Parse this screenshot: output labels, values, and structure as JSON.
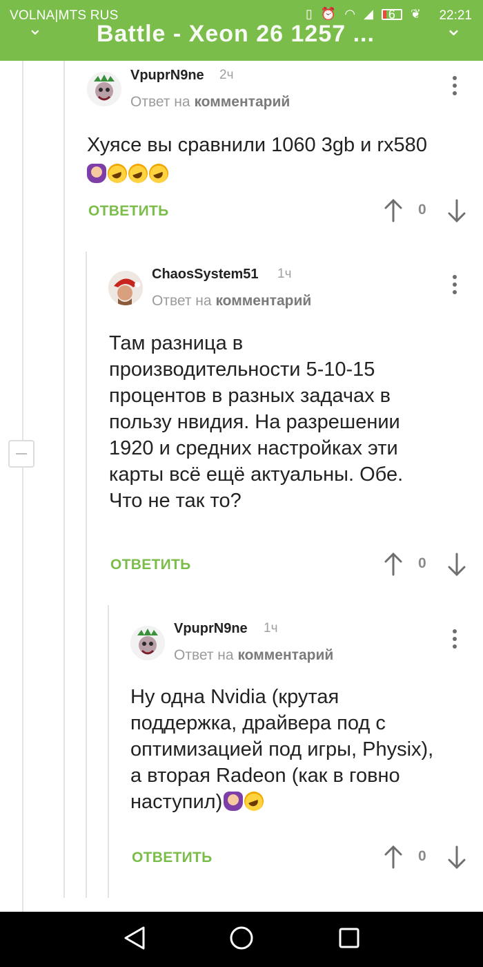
{
  "status_bar": {
    "carrier": "VOLNA|MTS RUS",
    "battery_level": "6",
    "time": "22:21"
  },
  "header": {
    "title_fragment": "Battle - Xeon 26 1257 ..."
  },
  "comments": [
    {
      "author": "VpuprN9ne",
      "ago": "2ч",
      "reply_prefix": "Ответ на",
      "reply_target": "комментарий",
      "text_line1": "Хуясе вы сравнили 1060 3gb и rx580",
      "reply_label": "ОТВЕТИТЬ",
      "score": "0"
    },
    {
      "author": "ChaosSystem51",
      "ago": "1ч",
      "reply_prefix": "Ответ на",
      "reply_target": "комментарий",
      "lines": [
        "Там разница в",
        "производительности 5-10-15",
        "процентов в разных задачах в",
        "пользу нвидия. На разрешении",
        "1920 и средних настройках эти",
        "карты всё ещё актуальны. Обе.",
        "Что не так то?"
      ],
      "reply_label": "ОТВЕТИТЬ",
      "score": "0"
    },
    {
      "author": "VpuprN9ne",
      "ago": "1ч",
      "reply_prefix": "Ответ на",
      "reply_target": "комментарий",
      "lines": [
        "Ну одна Nvidia (крутая",
        "поддержка, драйвера под с",
        "оптимизацией под игры, Physix),",
        "а вторая Radeon (как в говно",
        "наступил)"
      ],
      "reply_label": "ОТВЕТИТЬ",
      "score": "0"
    }
  ],
  "icons": {
    "upvote": "arrow-up-icon",
    "downvote": "arrow-down-icon",
    "more": "more-vertical-icon",
    "collapse": "collapse-minus-icon",
    "nav_back": "triangle-back-icon",
    "nav_home": "circle-home-icon",
    "nav_recent": "square-recent-icon"
  },
  "colors": {
    "brand_green": "#7bbd4a",
    "navbar": "#000000"
  }
}
